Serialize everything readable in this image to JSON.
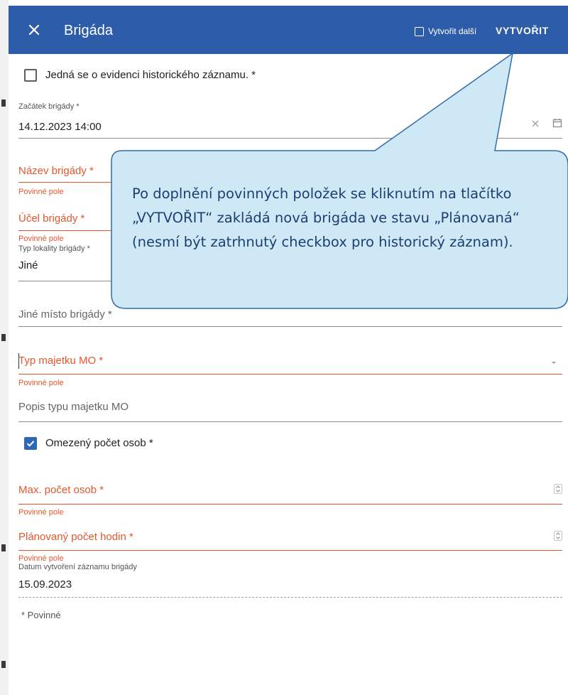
{
  "header": {
    "close_icon": "close-icon",
    "title": "Brigáda",
    "create_another_label": "Vytvořit další",
    "create_button_label": "VYTVOŘIT"
  },
  "form": {
    "historic_record": {
      "label": "Jedná se o evidenci historického záznamu. *",
      "checked": false
    },
    "start": {
      "label": "Začátek brigády *",
      "value": "14.12.2023 14:00",
      "clear_icon": "clear-icon",
      "calendar_icon": "calendar-icon"
    },
    "name": {
      "placeholder": "Název brigády *",
      "hint": "Povinné pole"
    },
    "purpose": {
      "placeholder": "Účel brigády *",
      "hint": "Povinné pole"
    },
    "locality_type": {
      "label": "Typ lokality brigády *",
      "value": "Jiné"
    },
    "other_place": {
      "placeholder": "Jiné místo brigády *"
    },
    "property_type": {
      "placeholder": "Typ majetku MO *",
      "hint": "Povinné pole",
      "dropdown_icon": "dropdown-arrow-icon"
    },
    "property_desc": {
      "placeholder": "Popis typu majetku MO"
    },
    "limited_persons": {
      "label": "Omezený počet osob *",
      "checked": true
    },
    "max_persons": {
      "placeholder": "Max. počet osob *",
      "hint": "Povinné pole",
      "spinner_icon": "number-spinner-icon"
    },
    "planned_hours": {
      "placeholder": "Plánovaný počet hodin *",
      "hint": "Povinné pole",
      "spinner_icon": "number-spinner-icon"
    },
    "created_date": {
      "label": "Datum vytvoření záznamu brigády",
      "value": "15.09.2023"
    },
    "required_note": "* Povinné"
  },
  "callout": {
    "text": "Po doplnění povinných položek se kliknutím na tlačítko „VYTVOŘIT“ zakládá nová brigáda ve stavu „Plánovaná“ (nesmí být zatrhnutý checkbox pro historický záznam).",
    "fill_color": "#cfe8f6",
    "border_color": "#2f6ca8"
  },
  "colors": {
    "header": "#2d5ca8",
    "error": "#e4572e",
    "checkbox": "#2f66b5"
  }
}
